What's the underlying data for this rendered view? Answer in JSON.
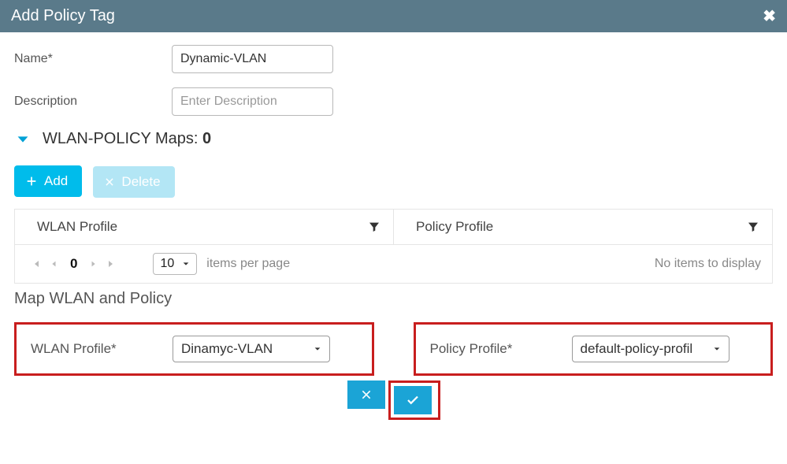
{
  "header": {
    "title": "Add Policy Tag"
  },
  "form": {
    "name_label": "Name*",
    "name_value": "Dynamic-VLAN",
    "desc_label": "Description",
    "desc_placeholder": "Enter Description"
  },
  "section": {
    "title_prefix": "WLAN-POLICY Maps: ",
    "count": "0"
  },
  "buttons": {
    "add": "Add",
    "delete": "Delete"
  },
  "table": {
    "col1": "WLAN Profile",
    "col2": "Policy Profile",
    "pager": {
      "current": "0",
      "page_size": "10",
      "items_per_page": "items per page",
      "empty": "No items to display"
    }
  },
  "map": {
    "title": "Map WLAN and Policy",
    "wlan_label": "WLAN Profile*",
    "wlan_value": "Dinamyc-VLAN",
    "policy_label": "Policy Profile*",
    "policy_value": "default-policy-profil"
  }
}
